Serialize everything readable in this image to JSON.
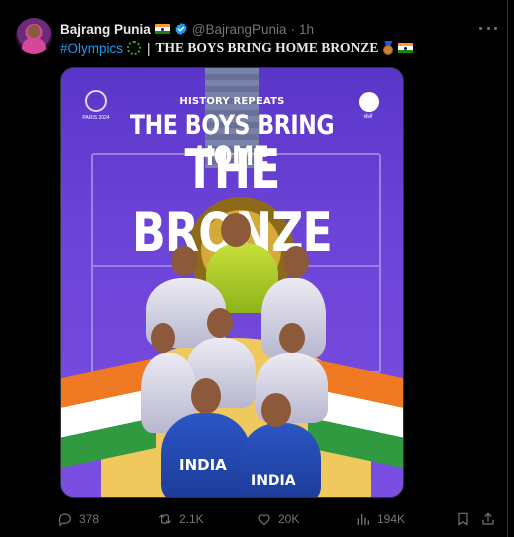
{
  "author": {
    "name": "Bajrang Punia",
    "handle": "@BajrangPunia",
    "separator": "·",
    "time": "1h"
  },
  "tweet": {
    "hashtag": "#Olympics",
    "pipe": "|",
    "headline": "THE BOYS BRING HOME BRONZE"
  },
  "image": {
    "kicker": "HISTORY REPEATS",
    "line1": "THE BOYS BRING HOME",
    "line2": "THE BRONZE",
    "jersey_text": "INDIA",
    "logo_left_text": "PARIS 2024",
    "logo_right_text": "खेलो"
  },
  "actions": {
    "replies": "378",
    "reposts": "2.1K",
    "likes": "20K",
    "views": "194K"
  },
  "icons": [
    "more-icon",
    "verified-icon",
    "india-flag-icon",
    "bronze-medal-icon",
    "wreath-icon",
    "reply-icon",
    "repost-icon",
    "like-icon",
    "views-icon",
    "bookmark-icon",
    "share-icon"
  ],
  "colors": {
    "accent": "#1d9bf0",
    "text": "#e7e9ea",
    "muted": "#71767b",
    "background": "#000000",
    "image_purple": "#6a3fd1"
  }
}
